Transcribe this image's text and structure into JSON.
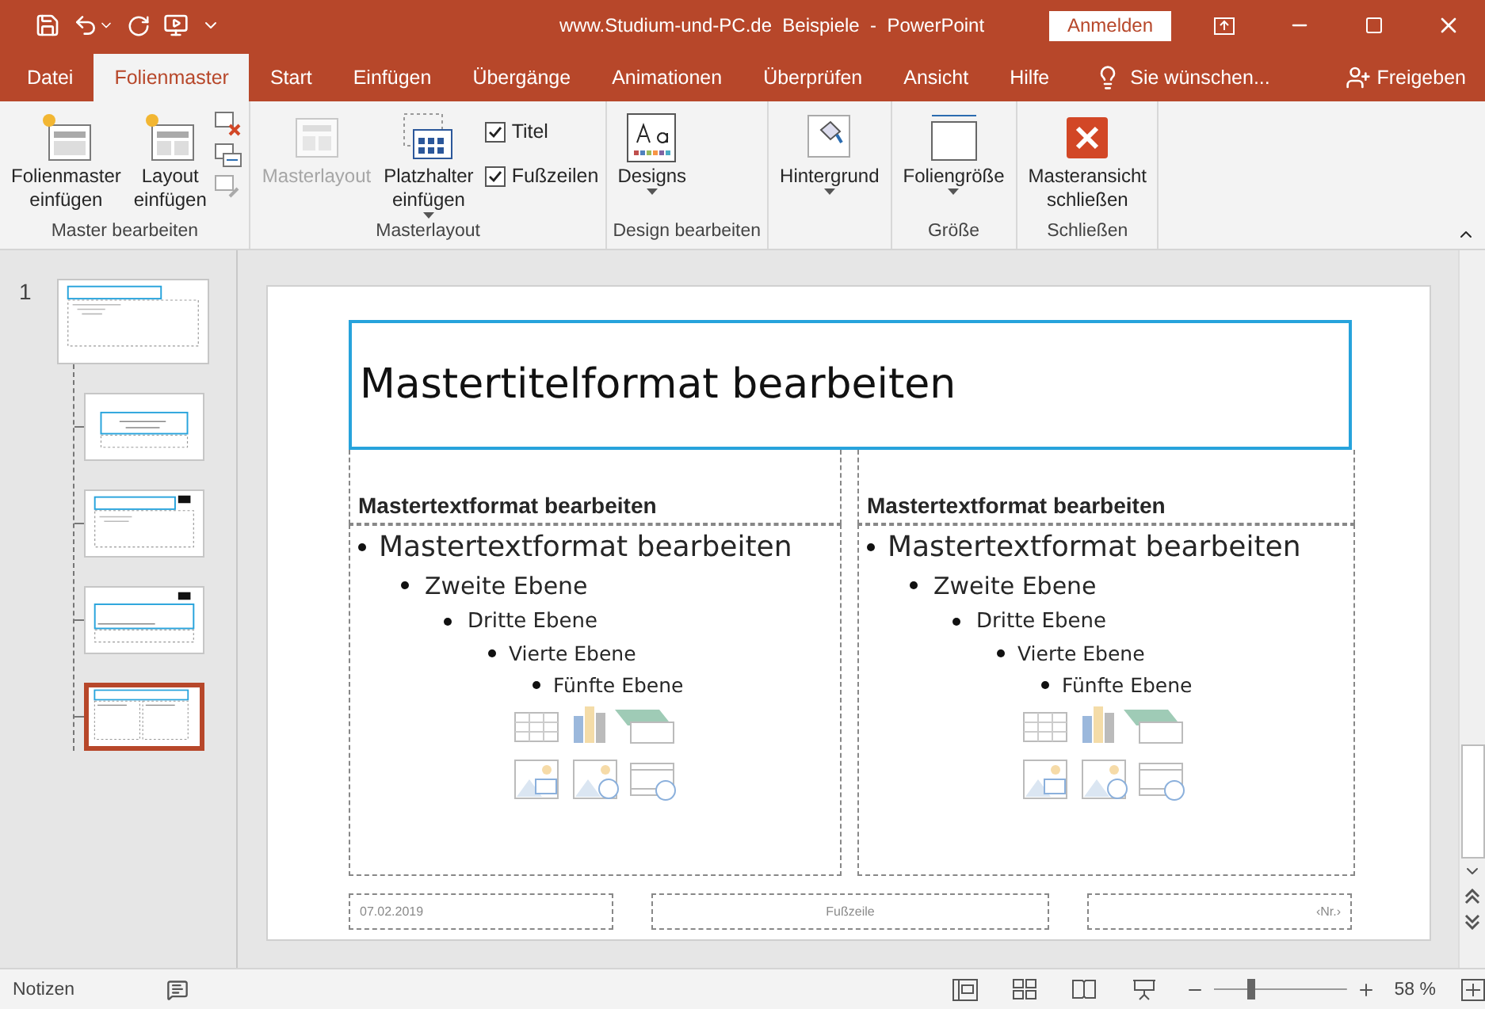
{
  "window": {
    "title": "www.Studium-und-PC.de  Beispiele  -  PowerPoint",
    "sign_in": "Anmelden"
  },
  "tabs": [
    {
      "label": "Datei",
      "selected": false
    },
    {
      "label": "Folienmaster",
      "selected": true
    },
    {
      "label": "Start",
      "selected": false
    },
    {
      "label": "Einfügen",
      "selected": false
    },
    {
      "label": "Übergänge",
      "selected": false
    },
    {
      "label": "Animationen",
      "selected": false
    },
    {
      "label": "Überprüfen",
      "selected": false
    },
    {
      "label": "Ansicht",
      "selected": false
    },
    {
      "label": "Hilfe",
      "selected": false
    }
  ],
  "tell_me": "Sie wünschen...",
  "share": "Freigeben",
  "ribbon_groups": [
    {
      "label": "Master bearbeiten",
      "controls": [
        {
          "kind": "master-insert",
          "lines": [
            "Folienmaster",
            "einfügen"
          ],
          "disabled": false,
          "dropdown": false
        },
        {
          "kind": "layout-insert",
          "lines": [
            "Layout",
            "einfügen"
          ],
          "disabled": false,
          "dropdown": false
        },
        {
          "kind": "icon-stack"
        }
      ]
    },
    {
      "label": "Masterlayout",
      "controls": [
        {
          "kind": "master-layout",
          "lines": [
            "Masterlayout"
          ],
          "disabled": true,
          "dropdown": false
        },
        {
          "kind": "placeholder",
          "lines": [
            "Platzhalter",
            "einfügen"
          ],
          "disabled": false,
          "dropdown": true
        },
        {
          "kind": "checks",
          "items": [
            {
              "label": "Titel",
              "checked": true
            },
            {
              "label": "Fußzeilen",
              "checked": true
            }
          ]
        }
      ]
    },
    {
      "label": "Design bearbeiten",
      "controls": [
        {
          "kind": "designs",
          "lines": [
            "Designs"
          ],
          "disabled": false,
          "dropdown": true
        }
      ]
    },
    {
      "controls": [
        {
          "kind": "background",
          "lines": [
            "Hintergrund"
          ],
          "disabled": false,
          "dropdown": true
        }
      ]
    },
    {
      "label": "Größe",
      "controls": [
        {
          "kind": "slide-size",
          "lines": [
            "Foliengröße"
          ],
          "disabled": false,
          "dropdown": true
        }
      ]
    },
    {
      "label": "Schließen",
      "controls": [
        {
          "kind": "close-master",
          "lines": [
            "Masteransicht",
            "schließen"
          ],
          "disabled": false,
          "dropdown": false
        }
      ]
    }
  ],
  "slides": [
    {
      "number": "1",
      "kind": "master",
      "selected": false,
      "children": [
        {
          "kind": "title",
          "selected": false
        },
        {
          "kind": "content",
          "selected": false
        },
        {
          "kind": "section",
          "selected": false
        },
        {
          "kind": "comparison",
          "selected": true
        }
      ]
    }
  ],
  "slide": {
    "title": "Mastertitelformat bearbeiten",
    "columns": [
      {
        "heading": "Mastertextformat bearbeiten",
        "items": [
          {
            "text": "Mastertextformat bearbeiten",
            "children": [
              {
                "text": "Zweite Ebene",
                "children": [
                  {
                    "text": "Dritte Ebene",
                    "children": [
                      {
                        "text": "Vierte Ebene",
                        "children": [
                          {
                            "text": "Fünfte Ebene"
                          }
                        ]
                      }
                    ]
                  }
                ]
              }
            ]
          }
        ]
      },
      {
        "heading": "Mastertextformat bearbeiten",
        "items": [
          {
            "text": "Mastertextformat bearbeiten",
            "children": [
              {
                "text": "Zweite Ebene",
                "children": [
                  {
                    "text": "Dritte Ebene",
                    "children": [
                      {
                        "text": "Vierte Ebene",
                        "children": [
                          {
                            "text": "Fünfte Ebene"
                          }
                        ]
                      }
                    ]
                  }
                ]
              }
            ]
          }
        ]
      }
    ],
    "footer": {
      "date": "07.02.2019",
      "text": "Fußzeile",
      "number": "‹Nr.›"
    }
  },
  "status_bar": {
    "notes": "Notizen",
    "zoom": "58 %",
    "zoom_slider": {
      "level": 0.28
    }
  }
}
